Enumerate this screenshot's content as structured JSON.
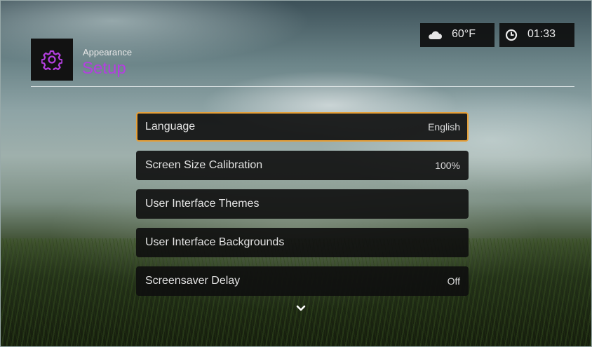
{
  "header": {
    "breadcrumb": "Appearance",
    "title": "Setup",
    "icon": "gear-icon",
    "title_color": "#b43fe0"
  },
  "status": {
    "weather_icon": "cloud-icon",
    "temperature": "60°F",
    "clock_icon": "clock-icon",
    "time": "01:33"
  },
  "menu": {
    "selected_border_color": "#e6a039",
    "items": [
      {
        "label": "Language",
        "value": "English",
        "selected": true
      },
      {
        "label": "Screen Size Calibration",
        "value": "100%"
      },
      {
        "label": "User Interface Themes",
        "value": ""
      },
      {
        "label": "User Interface Backgrounds",
        "value": ""
      },
      {
        "label": "Screensaver Delay",
        "value": "Off"
      }
    ],
    "scroll_icon": "chevron-down-icon"
  }
}
